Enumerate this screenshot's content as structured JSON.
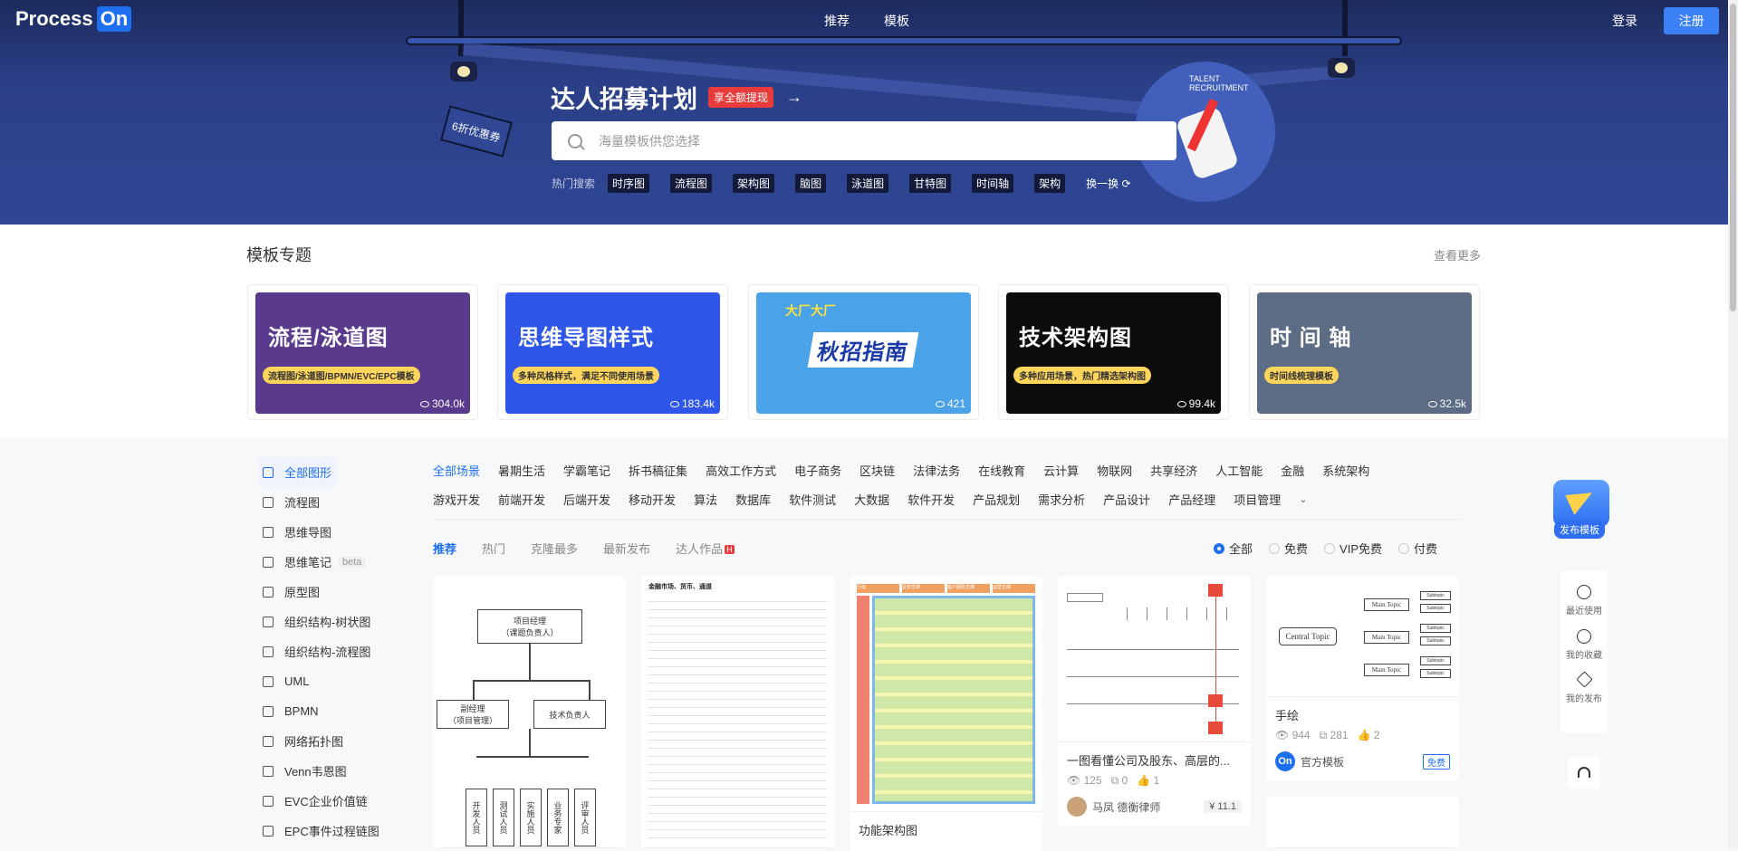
{
  "header": {
    "logo_text": "Process",
    "logo_on": "On",
    "nav": [
      "推荐",
      "模板"
    ],
    "login": "登录",
    "signup": "注册"
  },
  "hero": {
    "title": "达人招募计划",
    "badge": "享全额提现",
    "arrow": "→",
    "flag_text": "6折优惠券",
    "seal_text": "TALENT RECRUITMENT",
    "search_placeholder": "海量模板供您选择",
    "hot_label": "热门搜索",
    "hot_tags": [
      "时序图",
      "流程图",
      "架构图",
      "脑图",
      "泳道图",
      "甘特图",
      "时间轴",
      "架构"
    ],
    "swap": "换一换"
  },
  "topics": {
    "title": "模板专题",
    "more": "查看更多",
    "cards": [
      {
        "title": "流程/泳道图",
        "sub": "流程图/泳道图/BPMN/EVC/EPC模板",
        "views": "304.0k",
        "bg": "#5a3a8c"
      },
      {
        "title": "思维导图样式",
        "sub": "多种风格样式，满足不同使用场景",
        "views": "183.4k",
        "bg": "#2e56e8"
      },
      {
        "title": "秋招指南",
        "sub": "大厂大厂",
        "views": "421",
        "bg": "#4aa3e8"
      },
      {
        "title": "技术架构图",
        "sub": "多种应用场景，热门精选架构图",
        "views": "99.4k",
        "bg": "#0c0c0c"
      },
      {
        "title": "时 间 轴",
        "sub": "时间线梳理模板",
        "views": "32.5k",
        "bg": "#5c6c84"
      }
    ]
  },
  "sidebar": {
    "items": [
      {
        "label": "全部图形",
        "icon": "all-shapes-icon"
      },
      {
        "label": "流程图",
        "icon": "flowchart-icon"
      },
      {
        "label": "思维导图",
        "icon": "mindmap-icon"
      },
      {
        "label": "思维笔记",
        "icon": "notes-icon",
        "beta": "beta"
      },
      {
        "label": "原型图",
        "icon": "prototype-icon"
      },
      {
        "label": "组织结构-树状图",
        "icon": "org-tree-icon"
      },
      {
        "label": "组织结构-流程图",
        "icon": "org-flow-icon"
      },
      {
        "label": "UML",
        "icon": "uml-icon"
      },
      {
        "label": "BPMN",
        "icon": "bpmn-icon"
      },
      {
        "label": "网络拓扑图",
        "icon": "network-icon"
      },
      {
        "label": "Venn韦恩图",
        "icon": "venn-icon"
      },
      {
        "label": "EVC企业价值链",
        "icon": "evc-icon"
      },
      {
        "label": "EPC事件过程链图",
        "icon": "epc-icon"
      }
    ]
  },
  "categories": {
    "row1": [
      "全部场景",
      "暑期生活",
      "学霸笔记",
      "拆书稿征集",
      "高效工作方式",
      "电子商务",
      "区块链",
      "法律法务",
      "在线教育",
      "云计算",
      "物联网",
      "共享经济",
      "人工智能",
      "金融",
      "系统架构"
    ],
    "row2": [
      "游戏开发",
      "前端开发",
      "后端开发",
      "移动开发",
      "算法",
      "数据库",
      "软件测试",
      "大数据",
      "软件开发",
      "产品规划",
      "需求分析",
      "产品设计",
      "产品经理",
      "项目管理"
    ],
    "expand": "⌄"
  },
  "tabs": {
    "items": [
      "推荐",
      "热门",
      "克隆最多",
      "最新发布",
      "达人作品"
    ],
    "hot_badge": "H",
    "filters": [
      "全部",
      "免费",
      "VIP免费",
      "付费"
    ]
  },
  "templates": [
    {
      "name": "",
      "org_top": "项目经理\n（课题负责人）",
      "org_left": "副经理\n（项目管理）",
      "org_right": "技术负责人",
      "org_leaves": [
        "开发人员",
        "测试人员",
        "实施人员",
        "业务专家",
        "评审人员"
      ]
    },
    {
      "name": "",
      "doc_title": "金融市场、货币、通道"
    },
    {
      "name": "功能架构图",
      "header_labels": [
        "分级",
        "业务支撑",
        "客户服务支撑",
        "运营支撑"
      ]
    },
    {
      "name": "一图看懂公司及股东、高层的...",
      "views": "125",
      "clones": "0",
      "likes": "1",
      "author": "马凤 德衡律师",
      "price": "¥ 11.1"
    },
    {
      "name": "手绘",
      "views": "944",
      "clones": "281",
      "likes": "2",
      "author": "官方模板",
      "free": "免费",
      "center": "Central Topic",
      "main": "Main Topic",
      "sub": "Subtopic"
    }
  ],
  "rightbar": {
    "publish": "发布模板",
    "quick": [
      {
        "label": "最近使用",
        "icon": "eye-icon"
      },
      {
        "label": "我的收藏",
        "icon": "clock-icon"
      },
      {
        "label": "我的发布",
        "icon": "star-icon"
      }
    ],
    "support_icon": "headset-icon"
  }
}
